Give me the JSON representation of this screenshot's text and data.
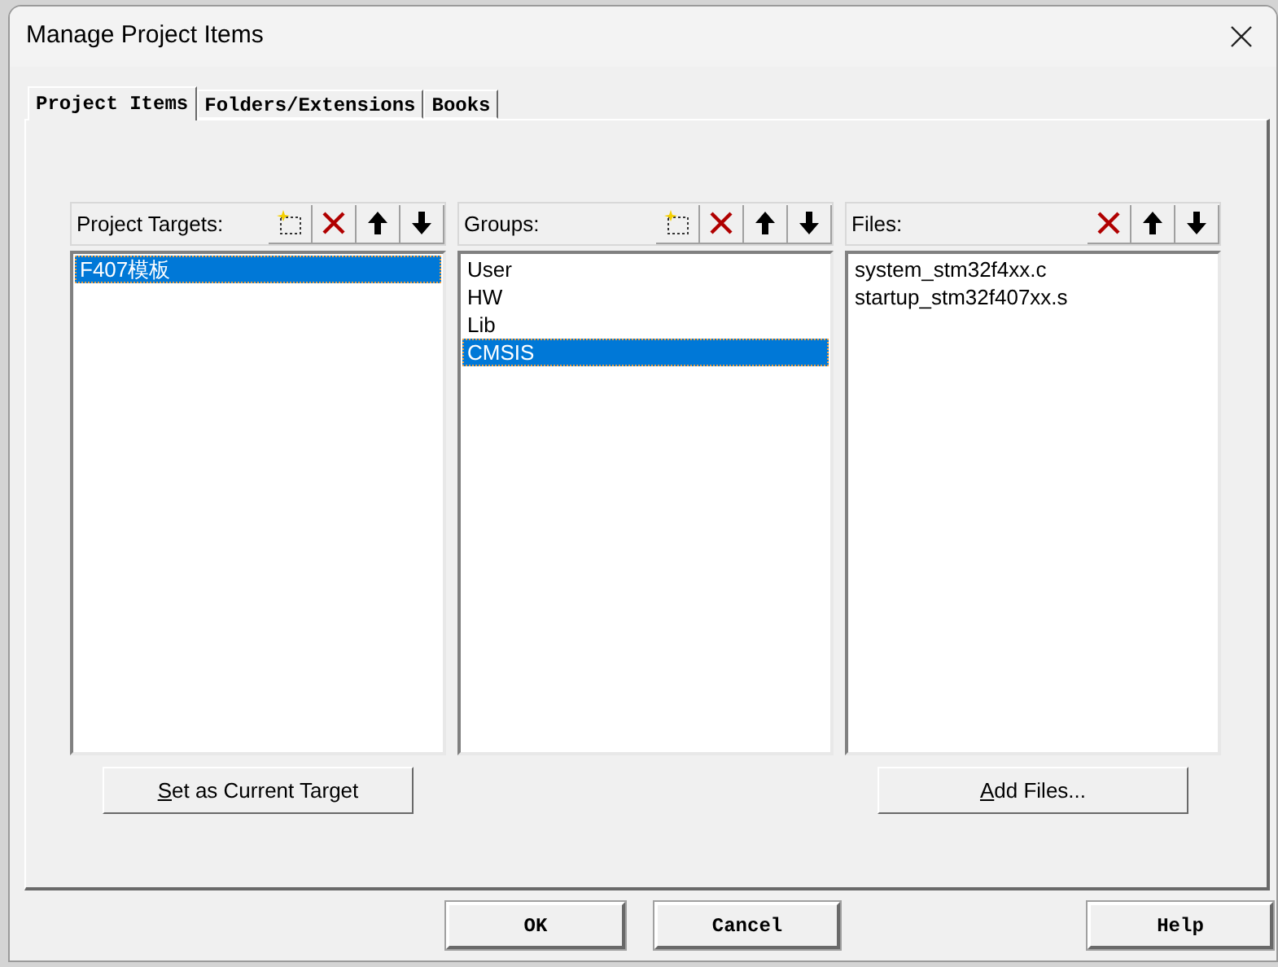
{
  "window": {
    "title": "Manage Project Items"
  },
  "tabs": [
    {
      "label": "Project Items",
      "selected": true
    },
    {
      "label": "Folders/Extensions",
      "selected": false
    },
    {
      "label": "Books",
      "selected": false
    }
  ],
  "panels": [
    {
      "label": "Project Targets:",
      "tools": [
        {
          "kind": "new"
        },
        {
          "kind": "delete"
        },
        {
          "kind": "up"
        },
        {
          "kind": "down"
        }
      ],
      "items": [
        {
          "label": "F407模板",
          "selected": true
        }
      ],
      "button": "Set as Current Target"
    },
    {
      "label": "Groups:",
      "tools": [
        {
          "kind": "new"
        },
        {
          "kind": "delete"
        },
        {
          "kind": "up"
        },
        {
          "kind": "down"
        }
      ],
      "items": [
        {
          "label": "User",
          "selected": false
        },
        {
          "label": "HW",
          "selected": false
        },
        {
          "label": "Lib",
          "selected": false
        },
        {
          "label": "CMSIS",
          "selected": true
        }
      ]
    },
    {
      "label": "Files:",
      "tools": [
        {
          "kind": "delete"
        },
        {
          "kind": "up"
        },
        {
          "kind": "down"
        }
      ],
      "items": [
        {
          "label": "system_stm32f4xx.c",
          "selected": false
        },
        {
          "label": "startup_stm32f407xx.s",
          "selected": false
        }
      ],
      "button": "Add Files..."
    }
  ],
  "buttons": [
    "OK",
    "Cancel",
    "Help"
  ]
}
